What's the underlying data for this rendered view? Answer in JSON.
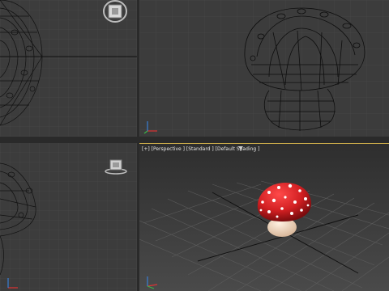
{
  "viewports": {
    "perspective": {
      "label": "[+] [Perspective ] [Standard ] [Default Shading ]"
    }
  },
  "colors": {
    "background": "#3c3c3c",
    "grid": "#4a4a4a",
    "wire": "#111111",
    "active_border": "#c8a94a",
    "cap": "#d21f22",
    "spots": "#ffffff",
    "stem": "#f2d7bf"
  },
  "icons": {
    "viewcube_top": "viewcube-icon",
    "viewcube_left": "viewcube-icon",
    "axis_tripod": "axis-tripod-icon",
    "filter": "filter-icon"
  }
}
